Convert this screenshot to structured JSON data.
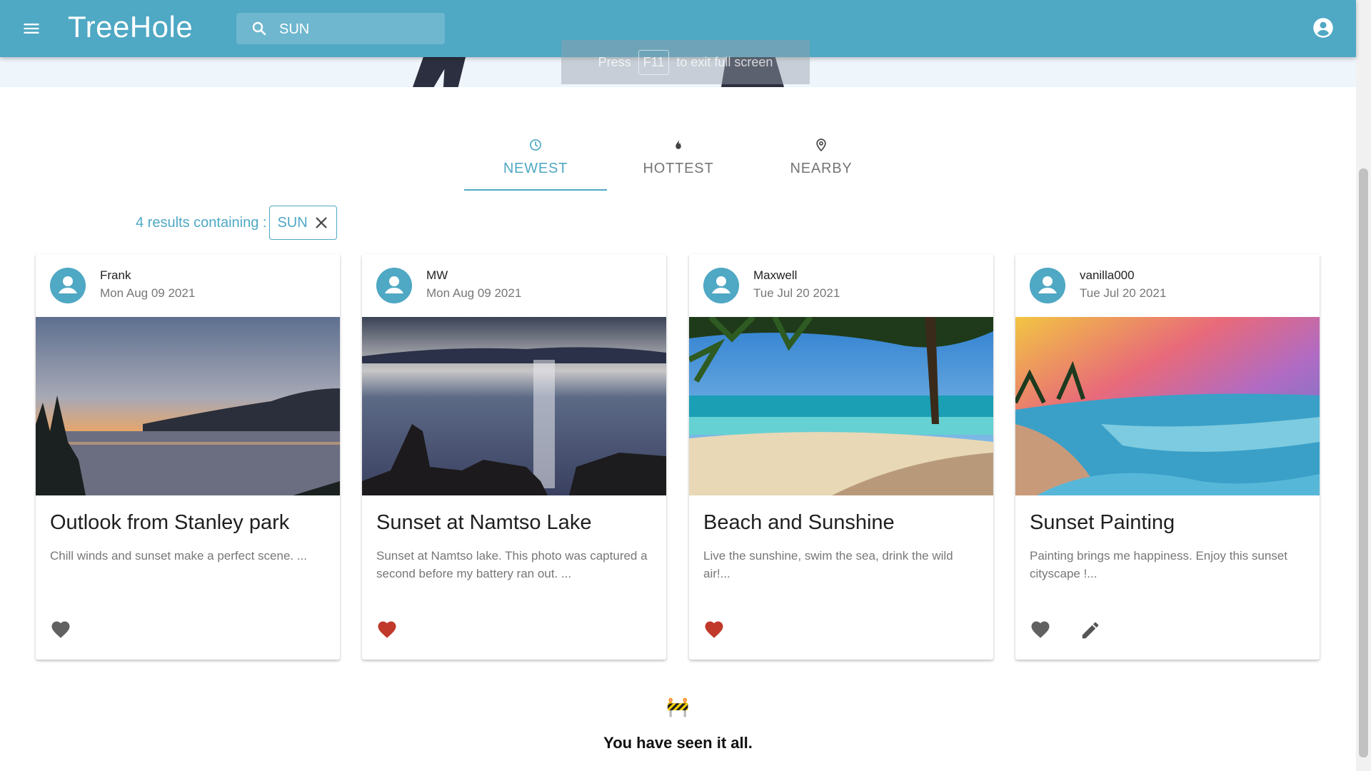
{
  "header": {
    "brand": "TreeHole",
    "search_value": "SUN",
    "search_icon": "search-icon",
    "menu_icon": "menu-icon",
    "account_icon": "account-icon"
  },
  "fullscreen_toast": {
    "press": "Press",
    "key": "F11",
    "suffix": "to exit full screen"
  },
  "tabs": [
    {
      "label": "NEWEST",
      "icon": "clock-icon",
      "active": true
    },
    {
      "label": "HOTTEST",
      "icon": "fire-icon",
      "active": false
    },
    {
      "label": "NEARBY",
      "icon": "location-icon",
      "active": false
    }
  ],
  "search_results": {
    "text": "4 results containing :",
    "chip_label": "SUN"
  },
  "posts": [
    {
      "author": "Frank",
      "date": "Mon Aug 09 2021",
      "title": "Outlook from Stanley park",
      "description": "Chill winds and sunset make a perfect scene. ...",
      "liked": false
    },
    {
      "author": "MW",
      "date": "Mon Aug 09 2021",
      "title": "Sunset at Namtso Lake",
      "description": "Sunset at Namtso lake. This photo was captured a second before my battery ran out. ...",
      "liked": true
    },
    {
      "author": "Maxwell",
      "date": "Tue Jul 20 2021",
      "title": "Beach and Sunshine",
      "description": "Live the sunshine, swim the sea, drink the wild air!...",
      "liked": true
    },
    {
      "author": "vanilla000",
      "date": "Tue Jul 20 2021",
      "title": "Sunset Painting",
      "description": "Painting brings me happiness. Enjoy this sunset cityscape !...",
      "liked": false,
      "editable": true
    }
  ],
  "end_of_feed": {
    "emoji": "🚧",
    "message": "You have seen it all."
  },
  "colors": {
    "primary": "#4fa8c4",
    "liked": "#c0392b",
    "unliked": "#616161"
  }
}
